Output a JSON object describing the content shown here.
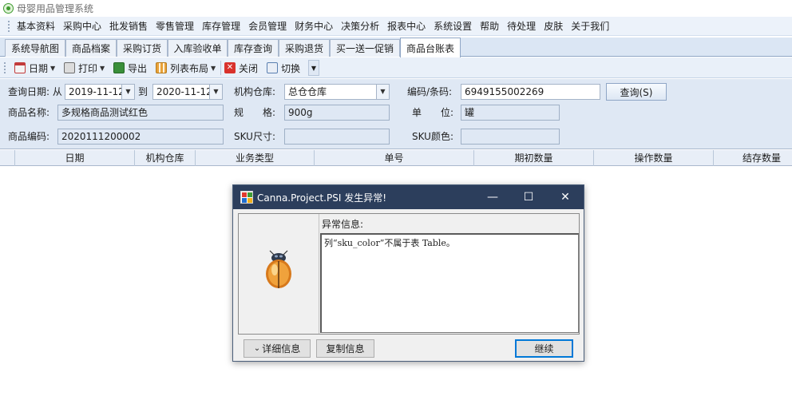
{
  "window": {
    "title": "母婴用品管理系统"
  },
  "menu": [
    "基本资料",
    "采购中心",
    "批发销售",
    "零售管理",
    "库存管理",
    "会员管理",
    "财务中心",
    "决策分析",
    "报表中心",
    "系统设置",
    "帮助",
    "待处理",
    "皮肤",
    "关于我们"
  ],
  "tabs": [
    {
      "label": "系统导航图"
    },
    {
      "label": "商品档案"
    },
    {
      "label": "采购订货"
    },
    {
      "label": "入库验收单"
    },
    {
      "label": "库存查询"
    },
    {
      "label": "采购退货"
    },
    {
      "label": "买一送一促销"
    },
    {
      "label": "商品台账表",
      "active": true
    }
  ],
  "toolbar": {
    "date_label": "日期",
    "print_label": "打印",
    "export_label": "导出",
    "layout_label": "列表布局",
    "close_label": "关闭",
    "switch_label": "切换"
  },
  "filters": {
    "query_date_label": "查询日期: 从",
    "date_from": "2019-11-12",
    "to_label": "到",
    "date_to": "2020-11-12",
    "warehouse_label": "机构仓库:",
    "warehouse_value": "总仓仓库",
    "code_label": "编码/条码:",
    "code_value": "6949155002269",
    "query_button": "查询(S)",
    "product_name_label": "商品名称:",
    "product_name_value": "多规格商品测试红色",
    "spec_label": "规　　格:",
    "spec_value": "900g",
    "unit_label": "单　　位:",
    "unit_value": "罐",
    "product_code_label": "商品编码:",
    "product_code_value": "2020111200002",
    "sku_size_label": "SKU尺寸:",
    "sku_size_value": "",
    "sku_color_label": "SKU颜色:",
    "sku_color_value": ""
  },
  "grid": {
    "columns": [
      "日期",
      "机构仓库",
      "业务类型",
      "单号",
      "期初数量",
      "操作数量",
      "结存数量"
    ],
    "rows": []
  },
  "dialog": {
    "title": "Canna.Project.PSI 发生异常!",
    "info_label": "异常信息:",
    "message": "列“sku_color”不属于表 Table。",
    "details_button": "详细信息",
    "copy_button": "复制信息",
    "continue_button": "继续",
    "minimize_glyph": "—",
    "maximize_glyph": "☐",
    "close_glyph": "✕",
    "expand_glyph": "⌄"
  },
  "colors": {
    "dialog_title_bg": "#2c3e5c",
    "filter_bg": "#dfe8f4",
    "tab_bar_bg": "#dbe6f4"
  }
}
